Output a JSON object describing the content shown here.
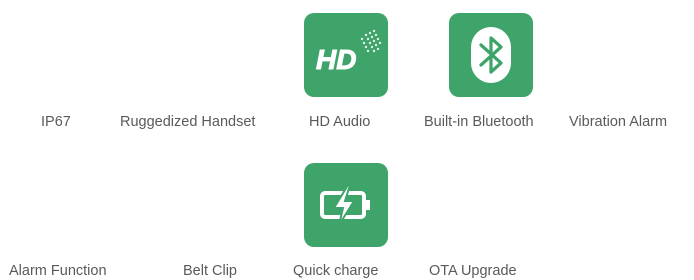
{
  "row1": {
    "features": [
      {
        "label": "IP67",
        "icon": null
      },
      {
        "label": "Ruggedized Handset",
        "icon": null
      },
      {
        "label": "HD Audio",
        "icon": "hd-audio-icon",
        "icon_text": "HD"
      },
      {
        "label": "Built-in Bluetooth",
        "icon": "bluetooth-icon"
      },
      {
        "label": "Vibration Alarm",
        "icon": null
      }
    ]
  },
  "row2": {
    "features": [
      {
        "label": "Alarm Function",
        "icon": null
      },
      {
        "label": "Belt Clip",
        "icon": null
      },
      {
        "label": "Quick charge",
        "icon": "battery-charge-icon"
      },
      {
        "label": "OTA Upgrade",
        "icon": null
      }
    ]
  },
  "colors": {
    "tile_green": "#3fa46a",
    "text_gray": "#5a5a5a"
  }
}
